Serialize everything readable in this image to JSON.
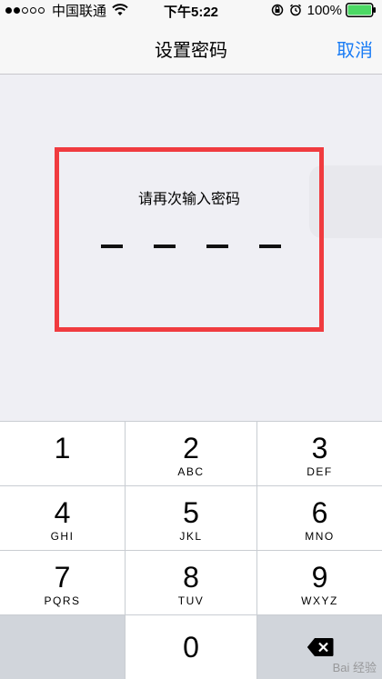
{
  "status_bar": {
    "carrier": "中国联通",
    "time": "下午5:22",
    "battery": "100%"
  },
  "nav": {
    "title": "设置密码",
    "cancel": "取消"
  },
  "passcode": {
    "prompt": "请再次输入密码",
    "slots": [
      "–",
      "–",
      "–",
      "–"
    ]
  },
  "keypad": {
    "keys": [
      {
        "number": "1",
        "letters": ""
      },
      {
        "number": "2",
        "letters": "ABC"
      },
      {
        "number": "3",
        "letters": "DEF"
      },
      {
        "number": "4",
        "letters": "GHI"
      },
      {
        "number": "5",
        "letters": "JKL"
      },
      {
        "number": "6",
        "letters": "MNO"
      },
      {
        "number": "7",
        "letters": "PQRS"
      },
      {
        "number": "8",
        "letters": "TUV"
      },
      {
        "number": "9",
        "letters": "WXYZ"
      },
      {
        "number": "0",
        "letters": ""
      }
    ]
  },
  "watermark": "Bai 经验",
  "colors": {
    "accent": "#1a7cf5",
    "highlight_box": "#f03b3f"
  }
}
